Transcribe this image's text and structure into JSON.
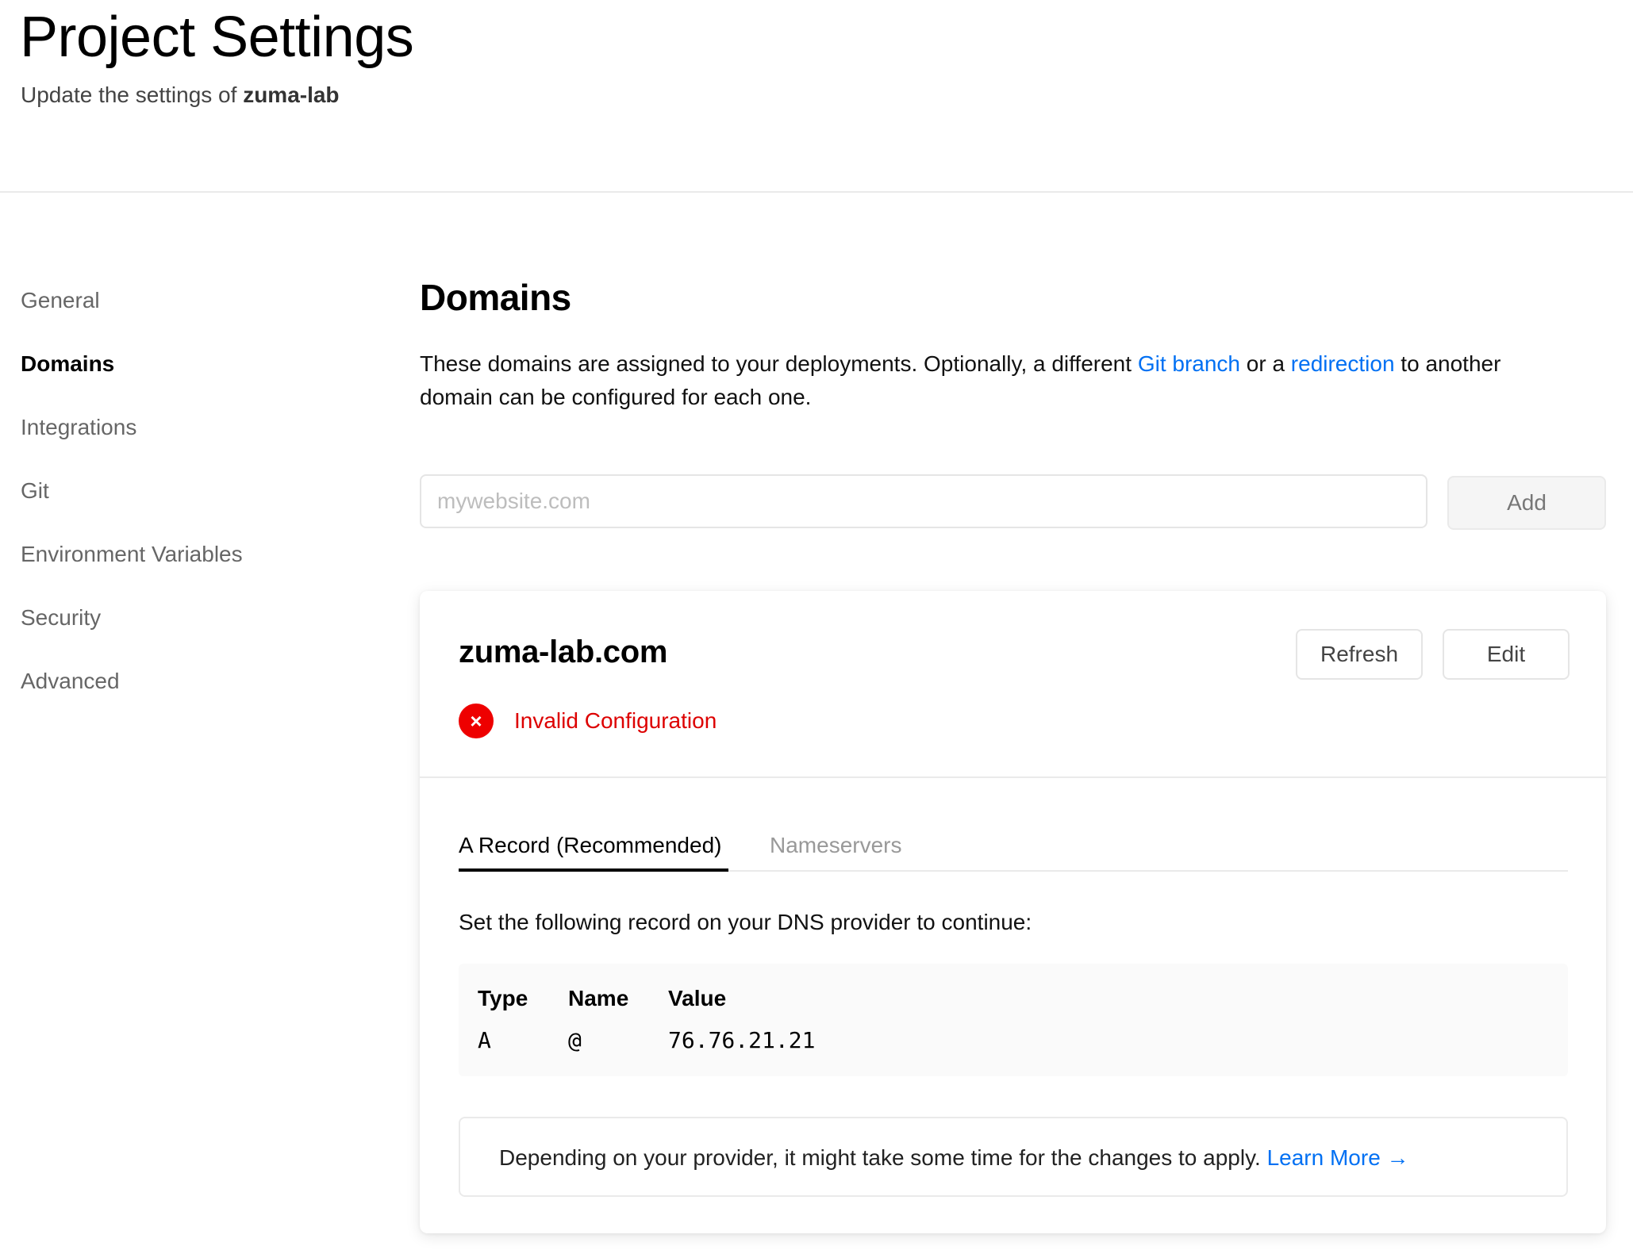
{
  "header": {
    "title": "Project Settings",
    "subtitle_prefix": "Update the settings of ",
    "project_name": "zuma-lab"
  },
  "sidebar": {
    "items": [
      {
        "label": "General",
        "active": false
      },
      {
        "label": "Domains",
        "active": true
      },
      {
        "label": "Integrations",
        "active": false
      },
      {
        "label": "Git",
        "active": false
      },
      {
        "label": "Environment Variables",
        "active": false
      },
      {
        "label": "Security",
        "active": false
      },
      {
        "label": "Advanced",
        "active": false
      }
    ]
  },
  "domains": {
    "title": "Domains",
    "description": {
      "part1": "These domains are assigned to your deployments. Optionally, a different ",
      "link1": "Git branch",
      "part2": " or a ",
      "link2": "redirection",
      "part3": " to another domain can be configured for each one."
    },
    "input_placeholder": "mywebsite.com",
    "input_value": "",
    "add_label": "Add"
  },
  "domain_card": {
    "domain": "zuma-lab.com",
    "refresh_label": "Refresh",
    "edit_label": "Edit",
    "status_icon": "×",
    "status": "Invalid Configuration",
    "tabs": [
      {
        "label": "A Record (Recommended)",
        "active": true
      },
      {
        "label": "Nameservers",
        "active": false
      }
    ],
    "instructions": "Set the following record on your DNS provider to continue:",
    "record": {
      "headers": [
        "Type",
        "Name",
        "Value"
      ],
      "values": [
        "A",
        "@",
        "76.76.21.21"
      ]
    },
    "note": "Depending on your provider, it might take some time for the changes to apply. ",
    "note_link": "Learn More →"
  },
  "colors": {
    "accent": "#0070f3",
    "error": "#ee0000",
    "border": "#eaeaea",
    "muted": "#666666"
  }
}
